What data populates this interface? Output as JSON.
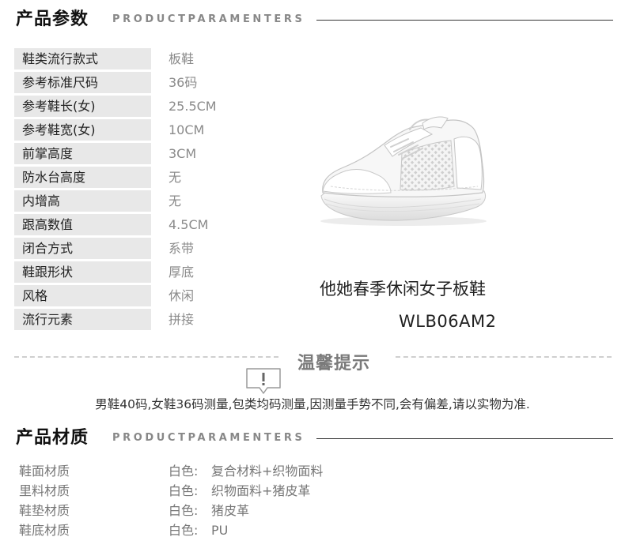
{
  "params_section": {
    "title": "产品参数",
    "subtitle": "PRODUCTPARAMENTERS"
  },
  "params": [
    {
      "key": "鞋类流行款式",
      "value": "板鞋"
    },
    {
      "key": "参考标准尺码",
      "value": "36码"
    },
    {
      "key": "参考鞋长(女)",
      "value": "25.5CM"
    },
    {
      "key": "参考鞋宽(女)",
      "value": "10CM"
    },
    {
      "key": "前掌高度",
      "value": "3CM"
    },
    {
      "key": "防水台高度",
      "value": "无"
    },
    {
      "key": "内增高",
      "value": "无"
    },
    {
      "key": "跟高数值",
      "value": "4.5CM"
    },
    {
      "key": "闭合方式",
      "value": "系带"
    },
    {
      "key": "鞋跟形状",
      "value": "厚底"
    },
    {
      "key": "风格",
      "value": "休闲"
    },
    {
      "key": "流行元素",
      "value": "拼接"
    }
  ],
  "product": {
    "name": "他她春季休闲女子板鞋",
    "code": "WLB06AM2",
    "image_icon": "white-sneaker-illustration"
  },
  "tip": {
    "title": "温馨提示",
    "icon": "exclamation-speech-bubble-icon",
    "text": "男鞋40码,女鞋36码测量,包类均码测量,因测量手势不同,会有偏差,请以实物为准."
  },
  "material_section": {
    "title": "产品材质",
    "subtitle": "PRODUCTPARAMENTERS"
  },
  "materials": [
    {
      "key": "鞋面材质",
      "color": "白色:",
      "value": "复合材料+织物面料"
    },
    {
      "key": "里料材质",
      "color": "白色:",
      "value": "织物面料+猪皮革"
    },
    {
      "key": "鞋垫材质",
      "color": "白色:",
      "value": "猪皮革"
    },
    {
      "key": "鞋底材质",
      "color": "白色:",
      "value": "PU"
    }
  ],
  "colors": {
    "header_rule": "#333333",
    "key_bg": "#e8e8e8",
    "value_text": "#8a8a8a"
  }
}
